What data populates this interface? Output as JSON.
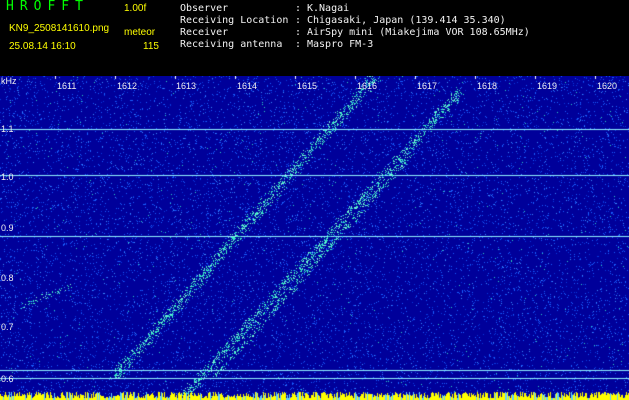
{
  "header": {
    "app_title": "HROFFT",
    "version": "1.00f",
    "file_name": "KN9_2508141610.png",
    "type_label": "meteor",
    "datetime": "25.08.14 16:10",
    "count": "115"
  },
  "info": [
    {
      "label": "Observer",
      "value": "K.Nagai"
    },
    {
      "label": "Receiving Location",
      "value": "Chigasaki, Japan (139.414 35.340)"
    },
    {
      "label": "Receiver",
      "value": "AirSpy mini (Miakejima VOR 108.65MHz)"
    },
    {
      "label": "Receiving antenna",
      "value": "Maspro FM-3"
    }
  ],
  "info_separator": ":",
  "axis": {
    "unit": "kHz",
    "freq_ticks": [
      "1.1",
      "1.0",
      "0.9",
      "0.8",
      "0.7",
      "0.6"
    ],
    "time_ticks": [
      "1611",
      "1612",
      "1613",
      "1614",
      "1615",
      "1616",
      "1617",
      "1618",
      "1619",
      "1620"
    ]
  },
  "colors": {
    "background": "#00009a",
    "noise": "#1a5fff",
    "signal": "#39f0c8",
    "hline": "#8ff0ff",
    "title": "#00ff00",
    "meta": "#ffff00",
    "baseline": "#ffff00"
  }
}
